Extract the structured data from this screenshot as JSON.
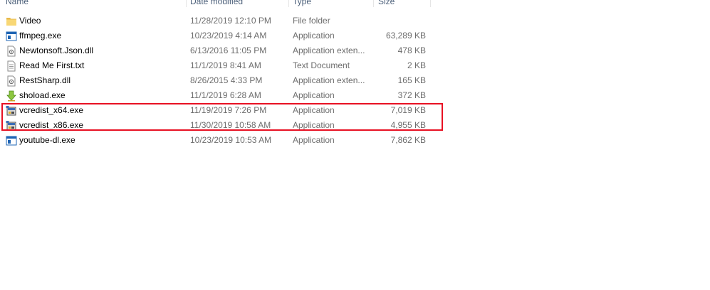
{
  "columns": {
    "name": "Name",
    "date_modified": "Date modified",
    "type": "Type",
    "size": "Size"
  },
  "files": [
    {
      "name": "Video",
      "date": "11/28/2019 12:10 PM",
      "type": "File folder",
      "size": "",
      "icon": "folder-icon"
    },
    {
      "name": "ffmpeg.exe",
      "date": "10/23/2019 4:14 AM",
      "type": "Application",
      "size": "63,289 KB",
      "icon": "exe-window-icon"
    },
    {
      "name": "Newtonsoft.Json.dll",
      "date": "6/13/2016 11:05 PM",
      "type": "Application exten...",
      "size": "478 KB",
      "icon": "dll-icon"
    },
    {
      "name": "Read Me First.txt",
      "date": "11/1/2019 8:41 AM",
      "type": "Text Document",
      "size": "2 KB",
      "icon": "text-file-icon"
    },
    {
      "name": "RestSharp.dll",
      "date": "8/26/2015 4:33 PM",
      "type": "Application exten...",
      "size": "165 KB",
      "icon": "dll-icon"
    },
    {
      "name": "shoload.exe",
      "date": "11/1/2019 6:28 AM",
      "type": "Application",
      "size": "372 KB",
      "icon": "download-arrow-icon"
    },
    {
      "name": "vcredist_x64.exe",
      "date": "11/19/2019 7:26 PM",
      "type": "Application",
      "size": "7,019 KB",
      "icon": "installer-icon"
    },
    {
      "name": "vcredist_x86.exe",
      "date": "11/30/2019 10:58 AM",
      "type": "Application",
      "size": "4,955 KB",
      "icon": "installer-icon"
    },
    {
      "name": "youtube-dl.exe",
      "date": "10/23/2019 10:53 AM",
      "type": "Application",
      "size": "7,862 KB",
      "icon": "exe-window-icon"
    }
  ],
  "colors": {
    "highlight": "#e81123",
    "folder": "#f8d775",
    "exe_blue": "#1e64b4"
  }
}
